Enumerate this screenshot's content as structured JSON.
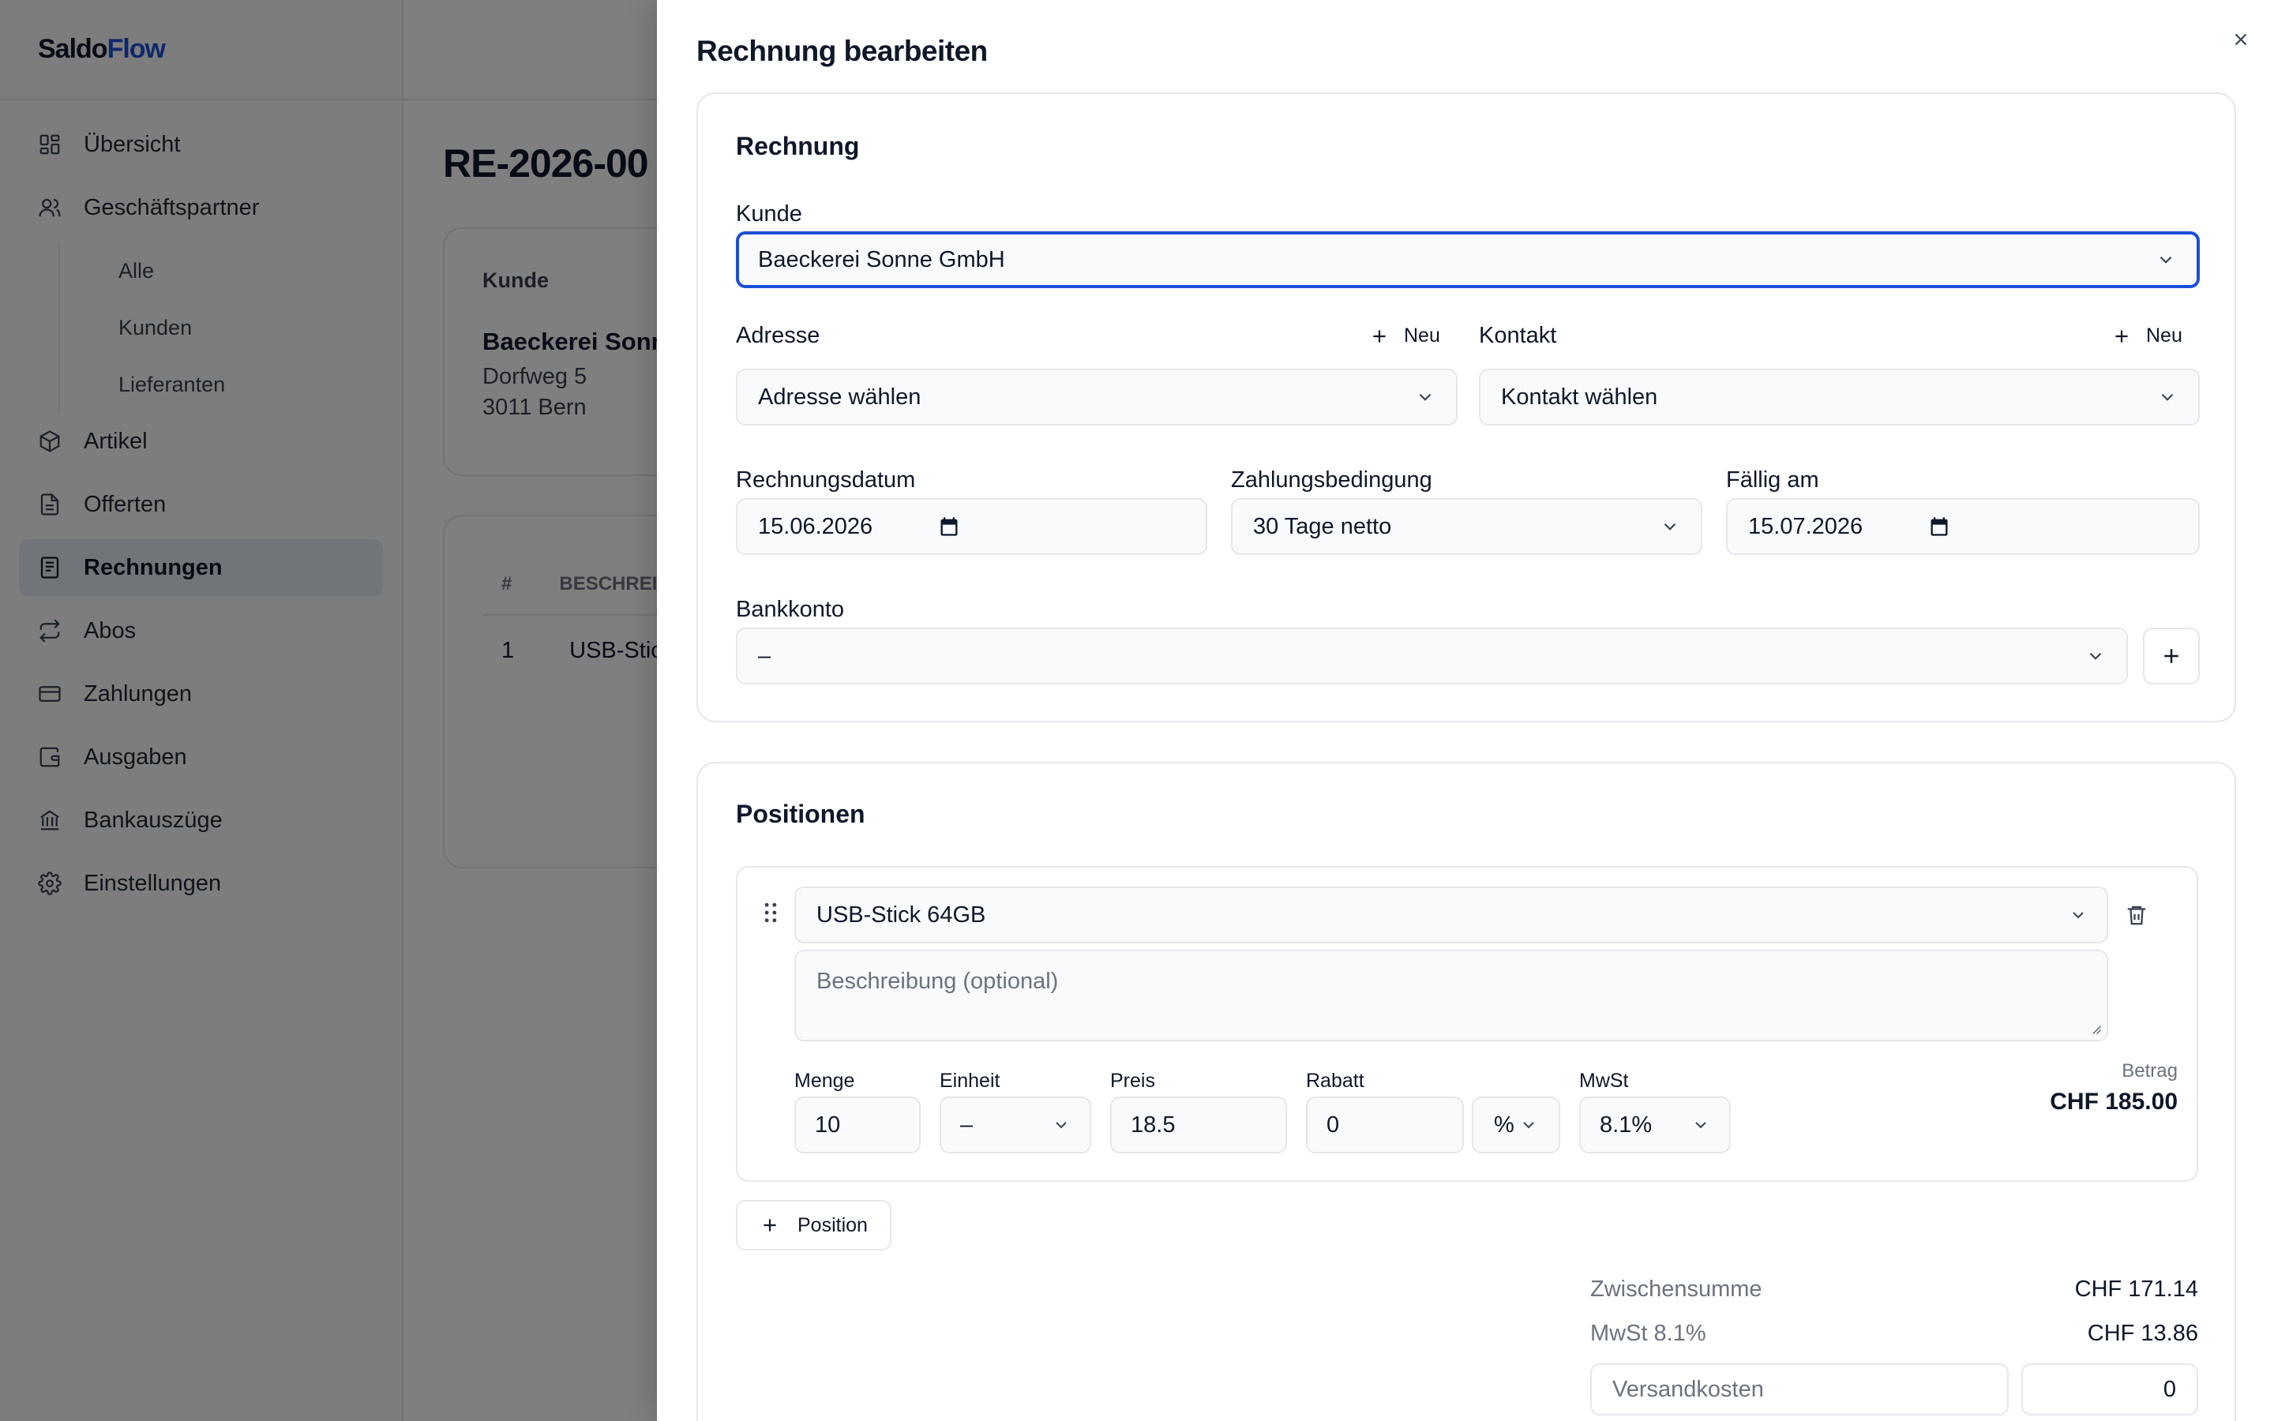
{
  "brand": {
    "part1": "Saldo",
    "part2": "Flow"
  },
  "sidebar": {
    "items": [
      {
        "label": "Übersicht",
        "icon": "dashboard-icon"
      },
      {
        "label": "Geschäftspartner",
        "icon": "users-icon"
      },
      {
        "label": "Alle"
      },
      {
        "label": "Kunden"
      },
      {
        "label": "Lieferanten"
      },
      {
        "label": "Artikel",
        "icon": "package-icon"
      },
      {
        "label": "Offerten",
        "icon": "file-icon"
      },
      {
        "label": "Rechnungen",
        "icon": "receipt-icon",
        "active": true
      },
      {
        "label": "Abos",
        "icon": "repeat-icon"
      },
      {
        "label": "Zahlungen",
        "icon": "credit-card-icon"
      },
      {
        "label": "Ausgaben",
        "icon": "wallet-icon"
      },
      {
        "label": "Bankauszüge",
        "icon": "bank-icon"
      },
      {
        "label": "Einstellungen",
        "icon": "gear-icon"
      }
    ]
  },
  "background_page": {
    "title": "RE-2026-00",
    "customer_card": {
      "label": "Kunde",
      "name": "Baeckerei Sonn",
      "street": "Dorfweg 5",
      "city": "3011 Bern"
    },
    "table": {
      "headers": [
        "#",
        "BESCHREI"
      ],
      "rows": [
        [
          "1",
          "USB-Stic"
        ]
      ]
    }
  },
  "sheet": {
    "title": "Rechnung bearbeiten",
    "invoice": {
      "section_title": "Rechnung",
      "customer": {
        "label": "Kunde",
        "value": "Baeckerei Sonne GmbH"
      },
      "address": {
        "label": "Adresse",
        "new_label": "Neu",
        "placeholder": "Adresse wählen"
      },
      "contact": {
        "label": "Kontakt",
        "new_label": "Neu",
        "placeholder": "Kontakt wählen"
      },
      "invoice_date": {
        "label": "Rechnungsdatum",
        "value": "15.06.2026"
      },
      "payment_terms": {
        "label": "Zahlungsbedingung",
        "value": "30 Tage netto"
      },
      "due_date": {
        "label": "Fällig am",
        "value": "15.07.2026"
      },
      "bank_account": {
        "label": "Bankkonto",
        "value": "–"
      }
    },
    "positions": {
      "section_title": "Positionen",
      "items": [
        {
          "article": "USB-Stick 64GB",
          "description_placeholder": "Beschreibung (optional)",
          "quantity_label": "Menge",
          "quantity": "10",
          "unit_label": "Einheit",
          "unit": "–",
          "price_label": "Preis",
          "price": "18.5",
          "discount_label": "Rabatt",
          "discount": "0",
          "discount_type": "%",
          "vat_label": "MwSt",
          "vat": "8.1%",
          "amount_label": "Betrag",
          "amount": "CHF 185.00"
        }
      ],
      "add_label": "Position"
    },
    "totals": {
      "subtotal_label": "Zwischensumme",
      "subtotal": "CHF 171.14",
      "vat_label": "MwSt 8.1%",
      "vat": "CHF 13.86",
      "shipping_label": "Versandkosten",
      "shipping": "0"
    }
  },
  "colors": {
    "accent": "#1d4ed8",
    "overlay": "rgba(0,0,0,0.5)",
    "border": "#e5e7eb"
  }
}
